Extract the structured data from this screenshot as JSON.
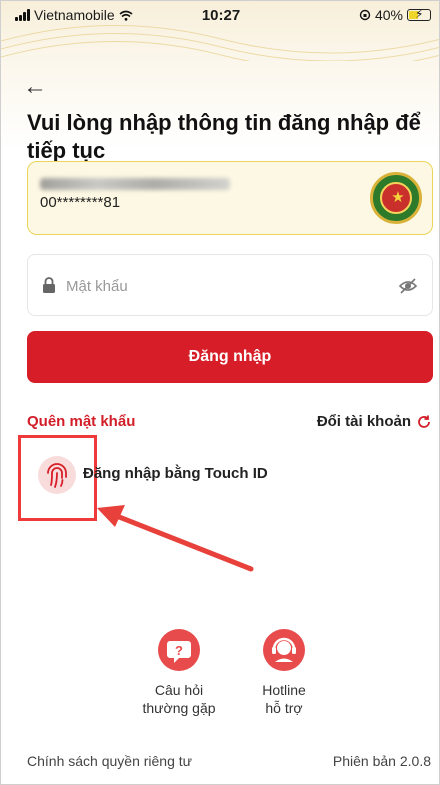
{
  "status_bar": {
    "carrier": "Vietnamobile",
    "time": "10:27",
    "battery": "40%"
  },
  "header": {
    "title": "Vui lòng nhập thông tin đăng nhập để tiếp tục"
  },
  "account": {
    "masked_id": "00********81"
  },
  "password_field": {
    "placeholder": "Mật khẩu",
    "value": ""
  },
  "login_button": {
    "label": "Đăng nhập"
  },
  "links": {
    "forgot_password": "Quên mật khẩu",
    "switch_account": "Đổi tài khoản"
  },
  "touch_id": {
    "label": "Đăng nhập bằng Touch ID"
  },
  "support": {
    "faq_line1": "Câu hỏi",
    "faq_line2": "thường gặp",
    "hotline_line1": "Hotline",
    "hotline_line2": "hỗ trợ"
  },
  "footer": {
    "privacy_policy": "Chính sách quyền riêng tư",
    "version": "Phiên bản 2.0.8"
  },
  "colors": {
    "primary_red": "#d71e28",
    "card_border": "#ead55a",
    "highlight_box": "#ee3a3a"
  },
  "icons": {
    "back": "arrow-left-icon",
    "lock": "lock-icon",
    "eye": "eye-off-icon",
    "refresh": "refresh-icon",
    "fingerprint": "fingerprint-icon",
    "faq": "question-icon",
    "hotline": "headset-icon",
    "emblem": "emblem-icon"
  }
}
